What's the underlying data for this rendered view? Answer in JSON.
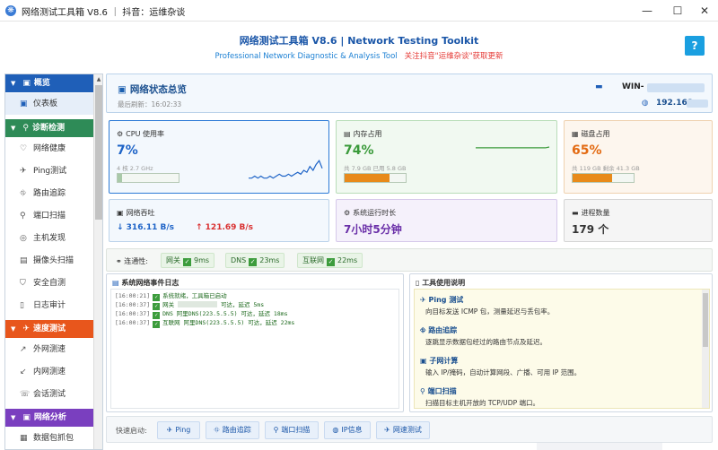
{
  "window": {
    "title": "网络测试工具箱 V8.6 ｜ 抖音：运维杂谈",
    "minimize": "—",
    "maximize": "☐",
    "close": "✕"
  },
  "header": {
    "title": "网络测试工具箱 V8.6 | Network Testing Toolkit",
    "subtitle_en": "Professional Network Diagnostic & Analysis Tool",
    "subtitle_cn": "关注抖音\"运维杂谈\"获取更新",
    "help": "?"
  },
  "sidebar": {
    "groups": {
      "overview": {
        "label": "概览",
        "color": "#1f5fb8"
      },
      "diagnostics": {
        "label": "诊断检测",
        "color": "#2e8b57"
      },
      "speed": {
        "label": "速度测试",
        "color": "#e8561c"
      },
      "analysis": {
        "label": "网络分析",
        "color": "#7a3fbf"
      }
    },
    "items": {
      "dashboard": "仪表板",
      "health": "网络健康",
      "ping": "Ping测试",
      "trace": "路由追踪",
      "portscan": "端口扫描",
      "hostfind": "主机发现",
      "camera": "摄像头扫描",
      "security": "安全自测",
      "logaudit": "日志审计",
      "extspeed": "外网测速",
      "intspeed": "内网测速",
      "session": "会话测试",
      "capture": "数据包抓包"
    }
  },
  "overview": {
    "title": "网络状态总览",
    "refresh": "最后刷新：16:02:33",
    "host": "WIN-",
    "ip": "192.168."
  },
  "cards": {
    "cpu": {
      "label": "CPU 使用率",
      "value": "7%",
      "detail": "4 核  2.7 GHz",
      "percent": 7
    },
    "memory": {
      "label": "内存占用",
      "value": "74%",
      "detail": "共 7.9 GB  已用 5.8 GB",
      "percent": 74
    },
    "disk": {
      "label": "磁盘占用",
      "value": "65%",
      "detail": "共 119 GB  剩余 41.3 GB",
      "percent": 65
    },
    "throughput": {
      "label": "网络吞吐",
      "down": "↓ 316.11 B/s",
      "up": "↑ 121.69 B/s"
    },
    "uptime": {
      "label": "系统运行时长",
      "value": "7小时5分钟"
    },
    "process": {
      "label": "进程数量",
      "value": "179 个"
    }
  },
  "connectivity": {
    "label": "连通性:",
    "gateway_label": "网关",
    "gateway_ms": "9ms",
    "dns_label": "DNS",
    "dns_ms": "23ms",
    "internet_label": "互联网",
    "internet_ms": "22ms"
  },
  "log": {
    "title": "系统网络事件日志",
    "lines": [
      {
        "ts": "[16:00:21]",
        "text": "系统就绪，工具箱已启动"
      },
      {
        "ts": "[16:00:37]",
        "text": "网关 ",
        "tail": " 可达，延迟 5ms"
      },
      {
        "ts": "[16:00:37]",
        "text": "DNS 阿里DNS(223.5.5.5) 可达，延迟 18ms"
      },
      {
        "ts": "[16:00:37]",
        "text": "互联网 阿里DNS(223.5.5.5) 可达，延迟 22ms"
      }
    ]
  },
  "guide": {
    "title": "工具使用说明",
    "items": [
      {
        "title": "Ping 测试",
        "desc": "向目标发送 ICMP 包，测量延迟与丢包率。"
      },
      {
        "title": "路由追踪",
        "desc": "逐跳显示数据包经过的路由节点及延迟。"
      },
      {
        "title": "子网计算",
        "desc": "输入 IP/掩码，自动计算网段、广播、可用 IP 范围。"
      },
      {
        "title": "端口扫描",
        "desc": "扫描目标主机开放的 TCP/UDP 端口。"
      }
    ]
  },
  "quick": {
    "label": "快速启动:",
    "buttons": [
      "Ping",
      "路由追踪",
      "端口扫描",
      "IP信息",
      "网速测试"
    ]
  },
  "chart_data": {
    "type": "line",
    "cpu_trend": [
      2,
      2,
      3,
      2,
      3,
      2,
      2,
      3,
      2,
      3,
      4,
      3,
      3,
      4,
      3,
      4,
      5,
      4,
      6,
      5,
      8,
      6,
      9,
      11,
      7
    ],
    "mem_trend": [
      74,
      74,
      74,
      74,
      74,
      74,
      74,
      74,
      74,
      74,
      74,
      74,
      74,
      74,
      74,
      74,
      74,
      74,
      74,
      75
    ]
  }
}
